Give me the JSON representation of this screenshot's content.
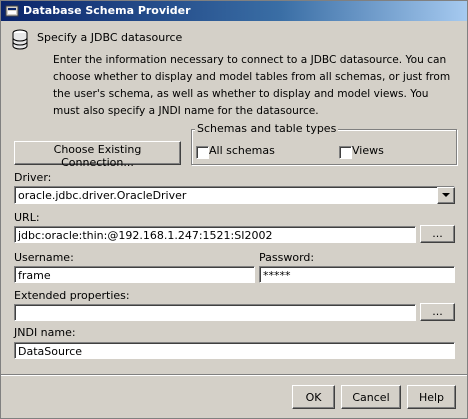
{
  "window": {
    "title": "Database Schema Provider"
  },
  "header": {
    "heading": "Specify a JDBC datasource",
    "description": "Enter the information necessary to connect to a JDBC datasource. You can choose whether to display and model tables from all schemas, or just from the user's schema, as well as whether to display and model views.  You must also specify a JNDI name for the datasource."
  },
  "connection": {
    "choose_button_label": "Choose Existing Connection..."
  },
  "schemas_group": {
    "label": "Schemas and table types",
    "all_schemas_label": "All schemas",
    "all_schemas_checked": false,
    "views_label": "Views",
    "views_checked": false
  },
  "driver": {
    "label": "Driver:",
    "value": "oracle.jdbc.driver.OracleDriver"
  },
  "url": {
    "label": "URL:",
    "value": "jdbc:oracle:thin:@192.168.1.247:1521:SI2002",
    "browse_label": "..."
  },
  "username": {
    "label": "Username:",
    "value": "frame"
  },
  "password": {
    "label": "Password:",
    "value": "*****"
  },
  "extended": {
    "label": "Extended properties:",
    "value": "",
    "browse_label": "..."
  },
  "jndi": {
    "label": "JNDI name:",
    "value": "DataSource"
  },
  "footer": {
    "ok_label": "OK",
    "cancel_label": "Cancel",
    "help_label": "Help"
  },
  "icons": [
    "database-icon",
    "app-icon",
    "dropdown-arrow-icon"
  ]
}
